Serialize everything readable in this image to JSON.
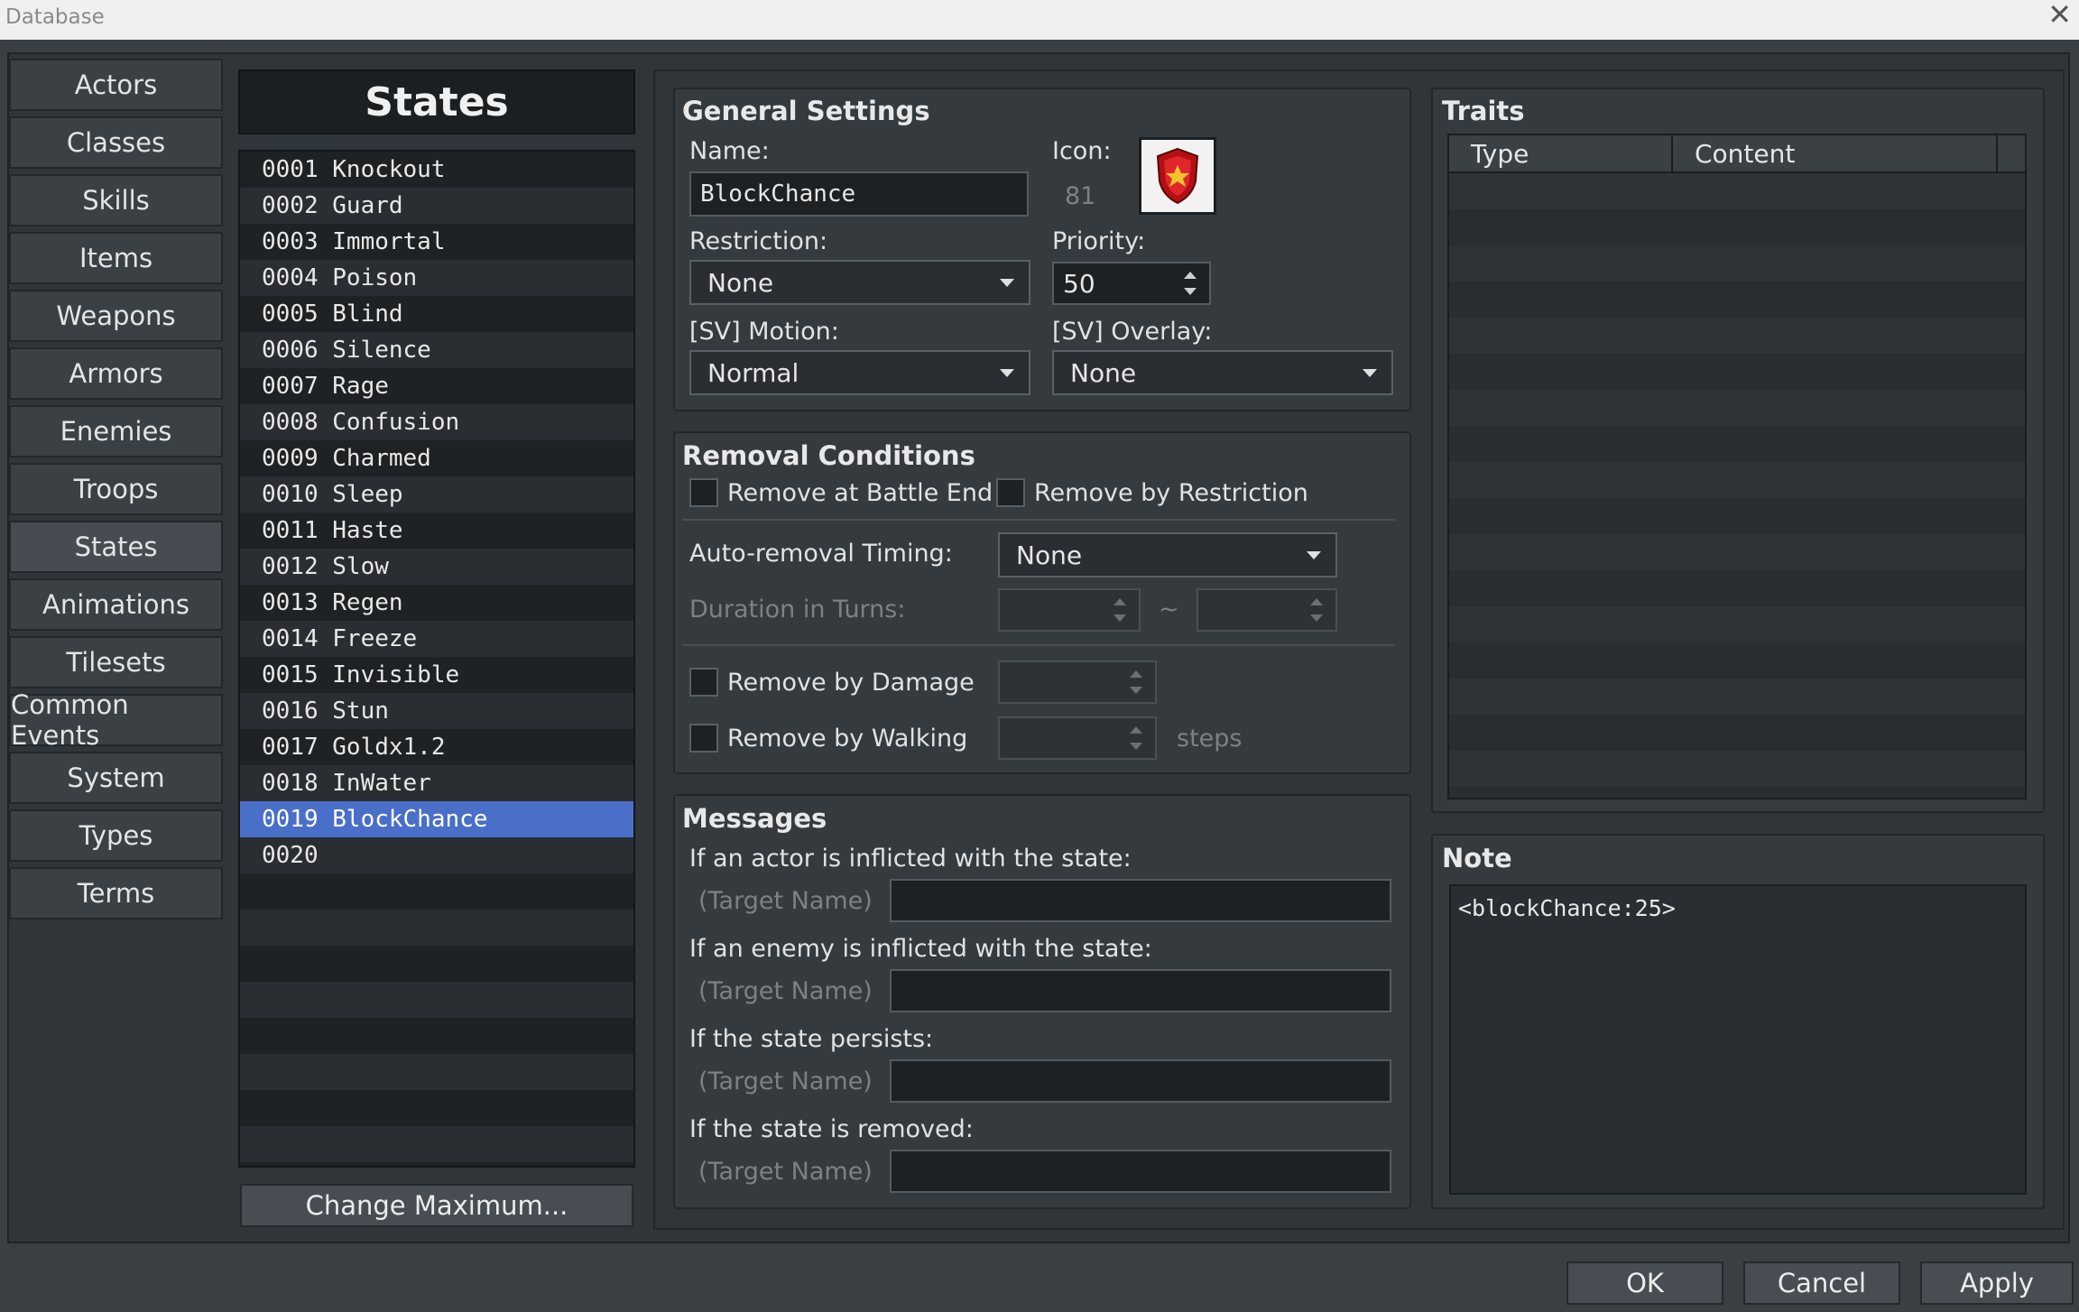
{
  "window": {
    "title": "Database",
    "close_glyph": "✕"
  },
  "categories": [
    {
      "label": "Actors"
    },
    {
      "label": "Classes"
    },
    {
      "label": "Skills"
    },
    {
      "label": "Items"
    },
    {
      "label": "Weapons"
    },
    {
      "label": "Armors"
    },
    {
      "label": "Enemies"
    },
    {
      "label": "Troops"
    },
    {
      "label": "States",
      "selected": true
    },
    {
      "label": "Animations"
    },
    {
      "label": "Tilesets"
    },
    {
      "label": "Common Events"
    },
    {
      "label": "System"
    },
    {
      "label": "Types"
    },
    {
      "label": "Terms"
    }
  ],
  "list": {
    "title": "States",
    "selected_index": 18,
    "items": [
      "0001 Knockout",
      "0002 Guard",
      "0003 Immortal",
      "0004 Poison",
      "0005 Blind",
      "0006 Silence",
      "0007 Rage",
      "0008 Confusion",
      "0009 Charmed",
      "0010 Sleep",
      "0011 Haste",
      "0012 Slow",
      "0013 Regen",
      "0014 Freeze",
      "0015 Invisible",
      "0016 Stun",
      "0017 Goldx1.2",
      "0018 InWater",
      "0019 BlockChance",
      "0020"
    ],
    "change_max_label": "Change Maximum..."
  },
  "general": {
    "title": "General Settings",
    "name_label": "Name:",
    "name_value": "BlockChance",
    "icon_label": "Icon:",
    "icon_index": "81",
    "icon_name": "shield-icon",
    "restriction_label": "Restriction:",
    "restriction_value": "None",
    "priority_label": "Priority:",
    "priority_value": "50",
    "motion_label": "[SV] Motion:",
    "motion_value": "Normal",
    "overlay_label": "[SV] Overlay:",
    "overlay_value": "None"
  },
  "removal": {
    "title": "Removal Conditions",
    "battle_end_label": "Remove at Battle End",
    "restriction_label": "Remove by Restriction",
    "timing_label": "Auto-removal Timing:",
    "timing_value": "None",
    "duration_label": "Duration in Turns:",
    "tilde": "~",
    "damage_label": "Remove by Damage",
    "walking_label": "Remove by Walking",
    "steps_label": "steps"
  },
  "messages": {
    "title": "Messages",
    "target_placeholder": "(Target Name)",
    "prompts": [
      "If an actor is inflicted with the state:",
      "If an enemy is inflicted with the state:",
      "If the state persists:",
      "If the state is removed:"
    ]
  },
  "traits": {
    "title": "Traits",
    "col_type": "Type",
    "col_content": "Content"
  },
  "note": {
    "title": "Note",
    "text": "<blockChance:25>"
  },
  "footer": {
    "ok": "OK",
    "cancel": "Cancel",
    "apply": "Apply"
  },
  "colors": {
    "selection": "#4a6fc9",
    "background": "#3a3f43"
  }
}
